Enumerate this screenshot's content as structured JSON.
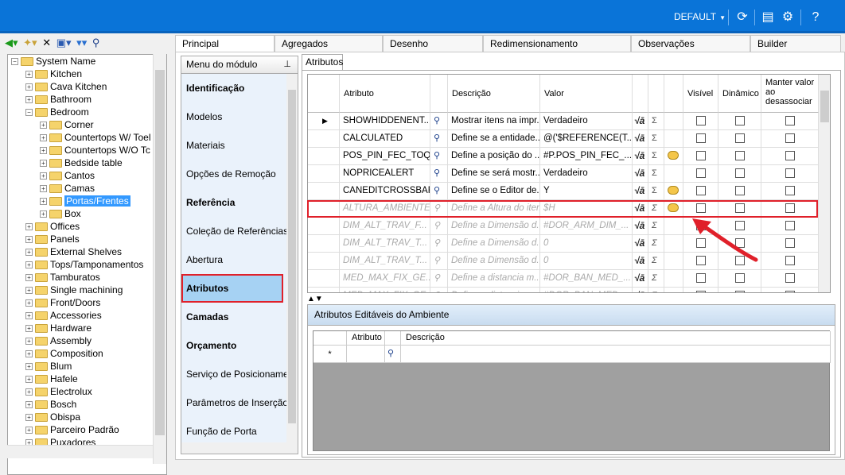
{
  "topbar": {
    "profile": "DEFAULT",
    "icons": [
      "refresh-icon",
      "layout-icon",
      "settings-icon",
      "help-icon"
    ],
    "color": "#0a74d8"
  },
  "tree": {
    "toolbar_icons": [
      "back-icon",
      "new-icon",
      "delete-icon",
      "copy-icon",
      "down-icon",
      "find-icon"
    ],
    "nodes": [
      {
        "label": "System Name",
        "level": 0,
        "expanded": true
      },
      {
        "label": "Kitchen",
        "level": 1
      },
      {
        "label": "Cava Kitchen",
        "level": 1
      },
      {
        "label": "Bathroom",
        "level": 1
      },
      {
        "label": "Bedroom",
        "level": 1,
        "expanded": true
      },
      {
        "label": "Corner",
        "level": 2
      },
      {
        "label": "Countertops W/ Toel",
        "level": 2
      },
      {
        "label": "Countertops W/O Tc",
        "level": 2
      },
      {
        "label": "Bedside table",
        "level": 2
      },
      {
        "label": "Cantos",
        "level": 2
      },
      {
        "label": "Camas",
        "level": 2
      },
      {
        "label": "Portas/Frentes",
        "level": 2,
        "selected": true
      },
      {
        "label": "Box",
        "level": 2
      },
      {
        "label": "Offices",
        "level": 1
      },
      {
        "label": "Panels",
        "level": 1
      },
      {
        "label": "External Shelves",
        "level": 1
      },
      {
        "label": "Tops/Tamponamentos",
        "level": 1
      },
      {
        "label": "Tamburatos",
        "level": 1
      },
      {
        "label": "Single machining",
        "level": 1
      },
      {
        "label": "Front/Doors",
        "level": 1
      },
      {
        "label": "Accessories",
        "level": 1
      },
      {
        "label": "Hardware",
        "level": 1
      },
      {
        "label": "Assembly",
        "level": 1
      },
      {
        "label": "Composition",
        "level": 1
      },
      {
        "label": "Blum",
        "level": 1
      },
      {
        "label": "Hafele",
        "level": 1
      },
      {
        "label": "Electrolux",
        "level": 1
      },
      {
        "label": "Bosch",
        "level": 1
      },
      {
        "label": "Obispa",
        "level": 1
      },
      {
        "label": "Parceiro Padrão",
        "level": 1
      },
      {
        "label": "Puxadores",
        "level": 1
      }
    ]
  },
  "tabs": [
    "Principal",
    "Agregados",
    "Desenho",
    "Redimensionamento",
    "Observações",
    "Builder"
  ],
  "module_menu": {
    "title": "Menu do módulo",
    "items": [
      {
        "label": "Identificação",
        "bold": true
      },
      {
        "label": "Modelos"
      },
      {
        "label": "Materiais"
      },
      {
        "label": "Opções de Remoção"
      },
      {
        "label": "Referência",
        "bold": true
      },
      {
        "label": "Coleção de Referências"
      },
      {
        "label": "Abertura"
      },
      {
        "label": "Atributos",
        "bold": true,
        "active": true
      },
      {
        "label": "Camadas",
        "bold": true
      },
      {
        "label": "Orçamento",
        "bold": true
      },
      {
        "label": "Serviço de Posicionamen"
      },
      {
        "label": "Parâmetros de Inserção"
      },
      {
        "label": "Função de Porta"
      }
    ]
  },
  "attributes": {
    "tab_label": "Atributos",
    "columns": {
      "attr": "Atributo",
      "desc": "Descrição",
      "value": "Valor",
      "visible": "Visível",
      "dynamic": "Dinâmico",
      "keep": "Manter valor ao desassociar"
    },
    "rows": [
      {
        "attr": "SHOWHIDDENENT...",
        "desc": "Mostrar itens na impr...",
        "value": "Verdadeiro",
        "bubble": false,
        "dim": false,
        "current": true
      },
      {
        "attr": "CALCULATED",
        "desc": "Define se a entidade...",
        "value": "@('$REFERENCE(T...",
        "bubble": false,
        "dim": false
      },
      {
        "attr": "POS_PIN_FEC_TOQ",
        "desc": "Define a posição do ...",
        "value": "#P.POS_PIN_FEC_...",
        "bubble": true,
        "dim": false
      },
      {
        "attr": "NOPRICEALERT",
        "desc": "Define se será mostr...",
        "value": "Verdadeiro",
        "bubble": false,
        "dim": false
      },
      {
        "attr": "CANEDITCROSSBAR",
        "desc": "Define se o Editor de...",
        "value": "Y",
        "bubble": true,
        "dim": false,
        "highlight": true
      },
      {
        "attr": "ALTURA_AMBIENTE",
        "desc": "Define a Altura do item",
        "value": "$H",
        "bubble": true,
        "dim": true
      },
      {
        "attr": "DIM_ALT_TRAV_F...",
        "desc": "Define a Dimensão d...",
        "value": "#DOR_ARM_DIM_...",
        "bubble": false,
        "dim": true
      },
      {
        "attr": "DIM_ALT_TRAV_T...",
        "desc": "Define a Dimensão d...",
        "value": "0",
        "bubble": false,
        "dim": true
      },
      {
        "attr": "DIM_ALT_TRAV_T...",
        "desc": "Define a Dimensão d...",
        "value": "0",
        "bubble": false,
        "dim": true
      },
      {
        "attr": "MED_MAX_FIX_GE...",
        "desc": "Define a distancia m...",
        "value": "#DOR_BAN_MED_...",
        "bubble": false,
        "dim": true
      },
      {
        "attr": "MED_MAX_FIX_GE...",
        "desc": "Define a distancia m...",
        "value": "#DOR_BAN_MED_...",
        "bubble": false,
        "dim": true
      }
    ]
  },
  "ambient": {
    "title": "Atributos Editáveis do Ambiente",
    "columns": {
      "attr": "Atributo",
      "desc": "Descrição"
    },
    "new_row_marker": "*"
  },
  "colors": {
    "highlight": "#e0202a",
    "accent": "#0a74d8",
    "menu_active": "#a6d2f3"
  }
}
